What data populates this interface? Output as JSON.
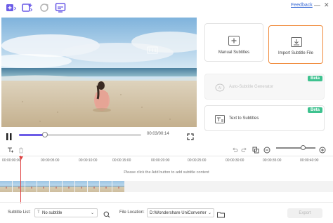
{
  "toolbar": {
    "icons": [
      "add-video-icon",
      "add-screen-icon",
      "refresh-icon",
      "subtitle-editor-icon"
    ],
    "feedback_label": "Feedback",
    "minimize_glyph": "—",
    "close_glyph": "✕"
  },
  "player": {
    "time_display": "00:03/00:14",
    "progress": 0.21
  },
  "cards": {
    "manual": {
      "label": "Manual Subtitles"
    },
    "import": {
      "label": "Import Subtitle File"
    },
    "auto": {
      "label": "Auto-Subtitle Generator",
      "badge": "Beta"
    },
    "tts": {
      "label": "Text to Subtitles",
      "badge": "Beta"
    }
  },
  "timeline": {
    "ticks": [
      "00:00:00:00",
      "00:00:05:00",
      "00:00:10:00",
      "00:00:15:00",
      "00:00:20:00",
      "00:00:25:00",
      "00:00:30:00",
      "00:00:35:00",
      "00:00:40:00"
    ],
    "hint": "Please click the Add button to add subtitle content",
    "zoom_level": 0.68,
    "frame_count": 10
  },
  "bottom": {
    "subtitle_list_label": "Subtitle List:",
    "subtitle_value": "No subtitle",
    "file_location_label": "File Location:",
    "file_location_value": "D:\\Wondershare UniConverter 1",
    "export_label": "Export"
  },
  "colors": {
    "accent": "#6c5ce7",
    "import_highlight": "#f08a3a",
    "beta_badge": "#3ec28f",
    "playhead": "#e04040",
    "link": "#3a6bd6"
  }
}
